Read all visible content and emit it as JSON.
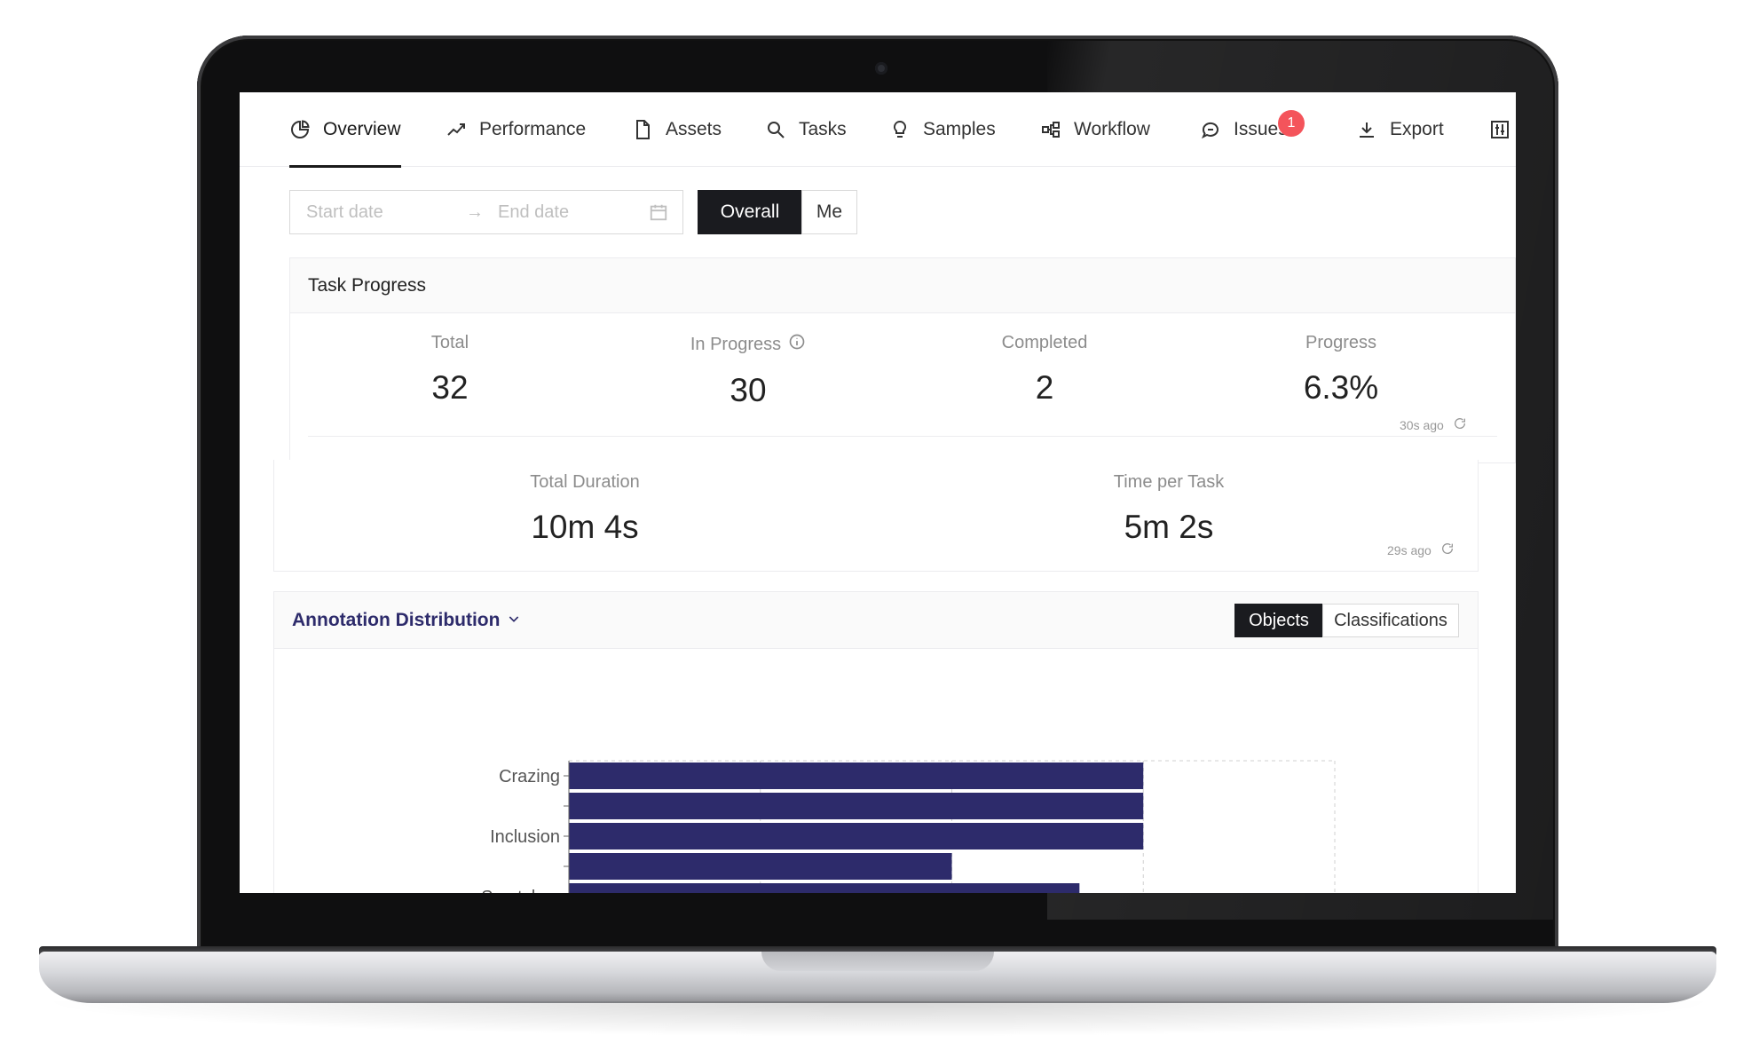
{
  "tabs": [
    {
      "label": "Overview",
      "icon": "pie-chart-icon",
      "active": true
    },
    {
      "label": "Performance",
      "icon": "trend-line-icon",
      "active": false
    },
    {
      "label": "Assets",
      "icon": "file-icon",
      "active": false
    },
    {
      "label": "Tasks",
      "icon": "search-icon",
      "active": false
    },
    {
      "label": "Samples",
      "icon": "lightbulb-icon",
      "active": false
    },
    {
      "label": "Workflow",
      "icon": "workflow-icon",
      "active": false
    },
    {
      "label": "Issues",
      "icon": "chat-bubble-icon",
      "active": false,
      "badge": "1"
    },
    {
      "label": "Export",
      "icon": "download-icon",
      "active": false
    }
  ],
  "filters": {
    "start_placeholder": "Start date",
    "end_placeholder": "End date",
    "arrow": "→",
    "scope_overall": "Overall",
    "scope_me": "Me",
    "scope_selected": "Overall"
  },
  "task_progress": {
    "title": "Task Progress",
    "stats": [
      {
        "label": "Total",
        "value": "32"
      },
      {
        "label": "In Progress",
        "value": "30"
      },
      {
        "label": "Completed",
        "value": "2"
      },
      {
        "label": "Progress",
        "value": "6.3%"
      }
    ],
    "updated": "30s ago"
  },
  "durations": {
    "stats": [
      {
        "label": "Total Duration",
        "value": "10m 4s"
      },
      {
        "label": "Time per Task",
        "value": "5m 2s"
      }
    ],
    "updated": "29s ago"
  },
  "annotation_distribution": {
    "title": "Annotation Distribution",
    "toggle_objects": "Objects",
    "toggle_classifications": "Classifications",
    "selected": "Objects"
  },
  "colors": {
    "bar": "#2d2b6b",
    "dark_button": "#1a1b1f",
    "badge": "#f4545b"
  },
  "chart_data": {
    "type": "bar",
    "orientation": "horizontal",
    "categories": [
      "Crazing",
      "",
      "Inclusion",
      "",
      "Scratches"
    ],
    "values": [
      9,
      9,
      9,
      6,
      8
    ],
    "xlim": [
      0,
      12
    ],
    "xticks": [
      0,
      3,
      6,
      9,
      12
    ],
    "grid": true,
    "title": "",
    "xlabel": "",
    "ylabel": ""
  }
}
